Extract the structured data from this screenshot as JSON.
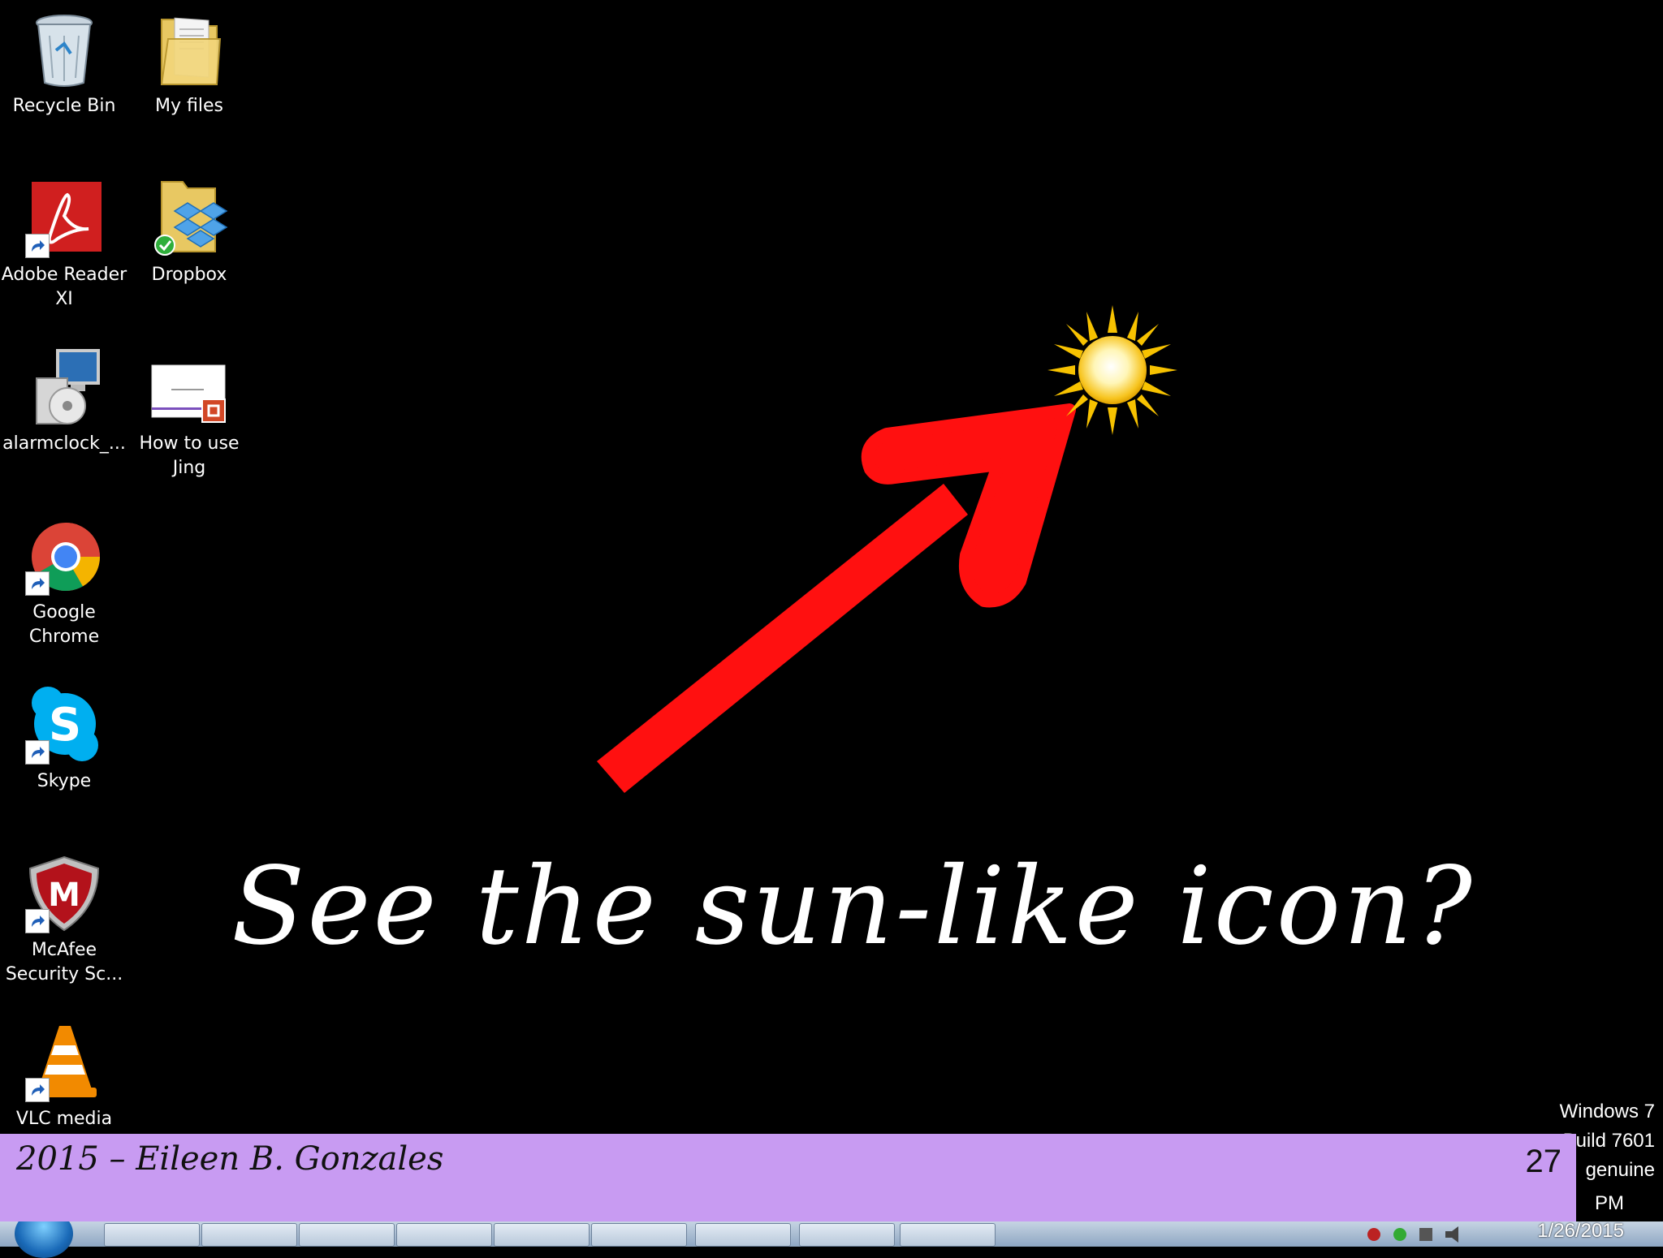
{
  "desktop_icons": [
    {
      "label": "Recycle Bin",
      "icon": "recycle-bin-icon"
    },
    {
      "label": "My files",
      "icon": "folder-icon"
    },
    {
      "label": "Adobe Reader\nXI",
      "icon": "adobe-reader-icon"
    },
    {
      "label": "Dropbox",
      "icon": "dropbox-folder-icon"
    },
    {
      "label": "alarmclock_...",
      "icon": "installer-icon"
    },
    {
      "label": "How to use\nJing",
      "icon": "powerpoint-document-icon"
    },
    {
      "label": "Google\nChrome",
      "icon": "chrome-icon"
    },
    {
      "label": "Skype",
      "icon": "skype-icon"
    },
    {
      "label": "McAfee\nSecurity Sc...",
      "icon": "mcafee-icon"
    },
    {
      "label": "VLC media",
      "icon": "vlc-icon"
    }
  ],
  "annotation": {
    "text": "See the sun-like icon?",
    "arrow_color": "#ff0000",
    "pointer_icon": "sun-icon"
  },
  "footer": {
    "credit": "2015 – Eileen B. Gonzales",
    "page_number": "27",
    "bar_color": "#c89bf2"
  },
  "watermark": {
    "line1": "Windows 7",
    "line2": "Build 7601",
    "line3": "genuine"
  },
  "taskbar": {
    "clock_time": "PM",
    "clock_date": "1/26/2015"
  }
}
